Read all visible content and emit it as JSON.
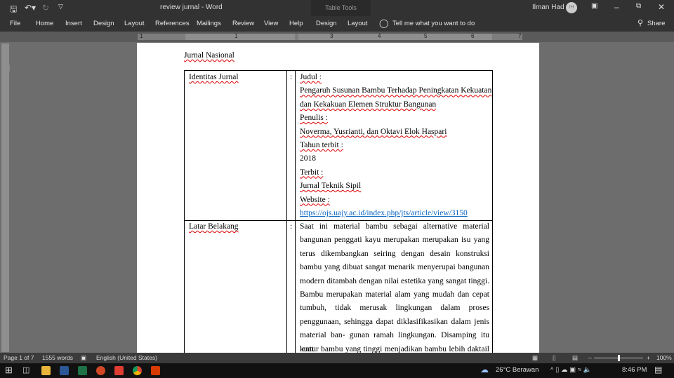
{
  "window": {
    "title": "review jurnal  -  Word",
    "contextual_tab": "Table Tools",
    "user": "Ilman Had",
    "user_initials": "IH"
  },
  "ribbon": {
    "tabs": [
      "File",
      "Home",
      "Insert",
      "Design",
      "Layout",
      "References",
      "Mailings",
      "Review",
      "View",
      "Help",
      "Design",
      "Layout"
    ],
    "tell_me": "Tell me what you want to do",
    "share": "Share"
  },
  "ruler": {
    "numbers": [
      "1",
      "1",
      "2",
      "3",
      "4",
      "5",
      "6",
      "7"
    ]
  },
  "document": {
    "heading": "Jurnal Nasional",
    "rows": [
      {
        "label": "Identitas Jurnal",
        "sep": ":",
        "lines": [
          "Judul :",
          "Pengaruh Susunan Bambu Terhadap Peningkatan Kekuatan",
          "dan Kekakuan Elemen Struktur Bangunan",
          "Penulis :",
          "Noverma, Yusrianti, dan Oktavi Elok Haspari",
          "Tahun terbit :",
          "2018",
          "Terbit :",
          "Jurnal Teknik Sipil",
          "Website :",
          "https://ojs.uajy.ac.id/index.php/jts/article/view/3150"
        ]
      },
      {
        "label": "Latar Belakang",
        "sep": ":",
        "lines": [
          "Saat ini material bambu sebagai alternative material",
          "bangunan penggati kayu merupakan merupakan isu yang",
          "terus dikembangkan seiring dengan desain konstruksi",
          "bambu yang dibuat sangat menarik menyerupai bangunan",
          "modern ditambah dengan nilai estetika yang sangat tinggi.",
          "Bambu merupakan material alam yang mudah dan cepat",
          "tumbuh, tidak merusak lingkungan dalam proses",
          "penggunaan, sehingga dapat diklasifikasikan dalam jenis",
          "material ban- gunan ramah lingkungan. Disamping itu kuat",
          "lentur bambu yang tinggi menjadikan bambu lebih daktail"
        ]
      }
    ]
  },
  "status": {
    "page": "Page 1 of 7",
    "words": "1555 words",
    "language": "English (United States)",
    "zoom": "100%"
  },
  "taskbar": {
    "weather": "26°C  Berawan",
    "time": "8:46 PM"
  }
}
